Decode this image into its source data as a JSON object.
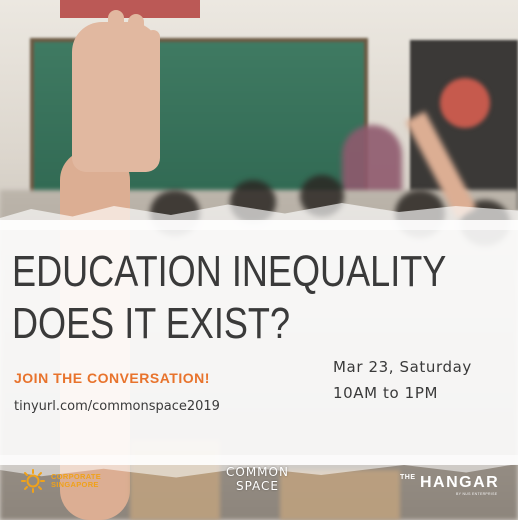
{
  "headline": {
    "line1": "EDUCATION INEQUALITY",
    "line2": "DOES IT EXIST?"
  },
  "call_to_action": "JOIN THE CONVERSATION!",
  "link": "tinyurl.com/commonspace2019",
  "event": {
    "date": "Mar 23, Saturday",
    "time": "10AM to 1PM"
  },
  "logos": {
    "corporate": [
      "CORPORATE",
      "SINGAPORE"
    ],
    "common_space": [
      "COMMON",
      "SPACE"
    ],
    "hangar": {
      "prefix": "THE",
      "name": "HANGAR",
      "tagline": "BY NUS ENTERPRISE"
    }
  },
  "colors": {
    "headline": "#3a3a3a",
    "accent_orange": "#e8732c",
    "logo_yellow": "#f0a21a"
  }
}
